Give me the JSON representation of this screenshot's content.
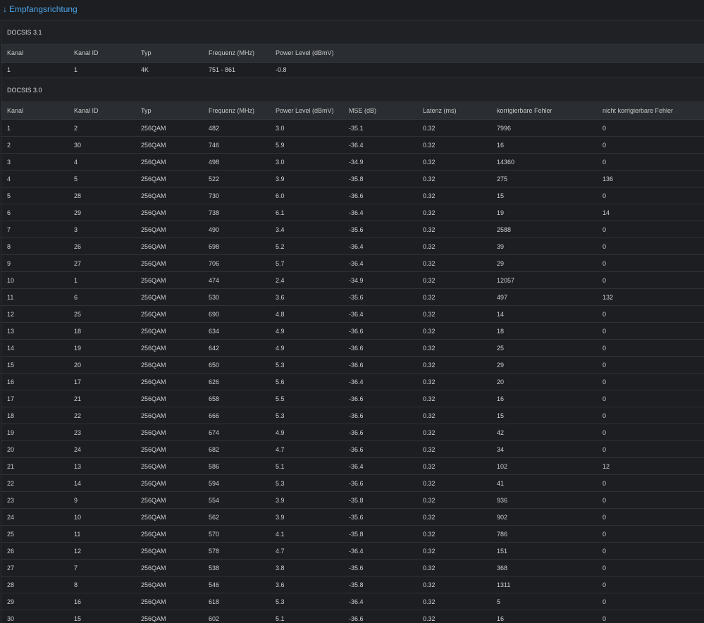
{
  "section_link": {
    "arrow": "↓",
    "label": "Empfangsrichtung"
  },
  "docsis31": {
    "title": "DOCSIS 3.1",
    "headers": [
      "Kanal",
      "Kanal ID",
      "Typ",
      "Frequenz (MHz)",
      "Power Level (dBmV)"
    ],
    "rows": [
      [
        "1",
        "1",
        "4K",
        "751 - 861",
        "-0.8"
      ]
    ]
  },
  "docsis30": {
    "title": "DOCSIS 3.0",
    "headers": [
      "Kanal",
      "Kanal ID",
      "Typ",
      "Frequenz (MHz)",
      "Power Level (dBmV)",
      "MSE (dB)",
      "Latenz (ms)",
      "korrigierbare Fehler",
      "nicht korrigierbare Fehler"
    ],
    "rows": [
      [
        "1",
        "2",
        "256QAM",
        "482",
        "3.0",
        "-35.1",
        "0.32",
        "7996",
        "0"
      ],
      [
        "2",
        "30",
        "256QAM",
        "746",
        "5.9",
        "-36.4",
        "0.32",
        "16",
        "0"
      ],
      [
        "3",
        "4",
        "256QAM",
        "498",
        "3.0",
        "-34.9",
        "0.32",
        "14360",
        "0"
      ],
      [
        "4",
        "5",
        "256QAM",
        "522",
        "3.9",
        "-35.8",
        "0.32",
        "275",
        "136"
      ],
      [
        "5",
        "28",
        "256QAM",
        "730",
        "6.0",
        "-36.6",
        "0.32",
        "15",
        "0"
      ],
      [
        "6",
        "29",
        "256QAM",
        "738",
        "6.1",
        "-36.4",
        "0.32",
        "19",
        "14"
      ],
      [
        "7",
        "3",
        "256QAM",
        "490",
        "3.4",
        "-35.6",
        "0.32",
        "2588",
        "0"
      ],
      [
        "8",
        "26",
        "256QAM",
        "698",
        "5.2",
        "-36.4",
        "0.32",
        "39",
        "0"
      ],
      [
        "9",
        "27",
        "256QAM",
        "706",
        "5.7",
        "-36.4",
        "0.32",
        "29",
        "0"
      ],
      [
        "10",
        "1",
        "256QAM",
        "474",
        "2.4",
        "-34.9",
        "0.32",
        "12057",
        "0"
      ],
      [
        "11",
        "6",
        "256QAM",
        "530",
        "3.6",
        "-35.6",
        "0.32",
        "497",
        "132"
      ],
      [
        "12",
        "25",
        "256QAM",
        "690",
        "4.8",
        "-36.4",
        "0.32",
        "14",
        "0"
      ],
      [
        "13",
        "18",
        "256QAM",
        "634",
        "4.9",
        "-36.6",
        "0.32",
        "18",
        "0"
      ],
      [
        "14",
        "19",
        "256QAM",
        "642",
        "4.9",
        "-36.6",
        "0.32",
        "25",
        "0"
      ],
      [
        "15",
        "20",
        "256QAM",
        "650",
        "5.3",
        "-36.6",
        "0.32",
        "29",
        "0"
      ],
      [
        "16",
        "17",
        "256QAM",
        "626",
        "5.6",
        "-36.4",
        "0.32",
        "20",
        "0"
      ],
      [
        "17",
        "21",
        "256QAM",
        "658",
        "5.5",
        "-36.6",
        "0.32",
        "16",
        "0"
      ],
      [
        "18",
        "22",
        "256QAM",
        "666",
        "5.3",
        "-36.6",
        "0.32",
        "15",
        "0"
      ],
      [
        "19",
        "23",
        "256QAM",
        "674",
        "4.9",
        "-36.6",
        "0.32",
        "42",
        "0"
      ],
      [
        "20",
        "24",
        "256QAM",
        "682",
        "4.7",
        "-36.6",
        "0.32",
        "34",
        "0"
      ],
      [
        "21",
        "13",
        "256QAM",
        "586",
        "5.1",
        "-36.4",
        "0.32",
        "102",
        "12"
      ],
      [
        "22",
        "14",
        "256QAM",
        "594",
        "5.3",
        "-36.6",
        "0.32",
        "41",
        "0"
      ],
      [
        "23",
        "9",
        "256QAM",
        "554",
        "3.9",
        "-35.8",
        "0.32",
        "936",
        "0"
      ],
      [
        "24",
        "10",
        "256QAM",
        "562",
        "3.9",
        "-35.6",
        "0.32",
        "902",
        "0"
      ],
      [
        "25",
        "11",
        "256QAM",
        "570",
        "4.1",
        "-35.8",
        "0.32",
        "786",
        "0"
      ],
      [
        "26",
        "12",
        "256QAM",
        "578",
        "4.7",
        "-36.4",
        "0.32",
        "151",
        "0"
      ],
      [
        "27",
        "7",
        "256QAM",
        "538",
        "3.8",
        "-35.6",
        "0.32",
        "368",
        "0"
      ],
      [
        "28",
        "8",
        "256QAM",
        "546",
        "3.6",
        "-35.8",
        "0.32",
        "1311",
        "0"
      ],
      [
        "29",
        "16",
        "256QAM",
        "618",
        "5.3",
        "-36.4",
        "0.32",
        "5",
        "0"
      ],
      [
        "30",
        "15",
        "256QAM",
        "602",
        "5.1",
        "-36.6",
        "0.32",
        "16",
        "0"
      ]
    ]
  },
  "colors": {
    "background": "#1c1e21",
    "header_row": "#2a2d31",
    "link": "#4da3e6",
    "divider": "#2e3237"
  }
}
